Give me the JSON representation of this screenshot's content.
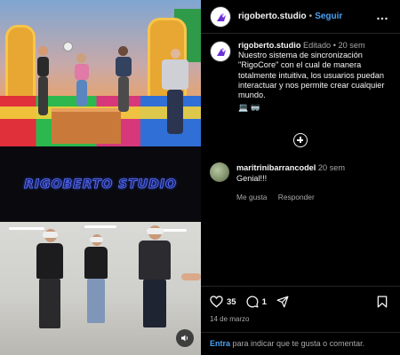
{
  "media": {
    "logo_text": "RIGOBERTO STUDIO",
    "sound_icon": "speaker-icon"
  },
  "post": {
    "username": "rigoberto.studio",
    "follow_label": "Seguir",
    "separator": "•",
    "more_icon": "more-icon",
    "caption_username": "rigoberto.studio",
    "edited_label": "Editado",
    "caption_time": "20 sem",
    "caption_text": "Nuestro sistema de sincronización \"RigoCore\" con el cual de manera totalmente intuitiva, los usuarios puedan interactuar y nos permite crear cualquier mundo.",
    "caption_emojis": "💻 🥽"
  },
  "comments": [
    {
      "username": "maritrinibarrancodel",
      "time": "20 sem",
      "text": "Genial!!!",
      "like_label": "Me gusta",
      "reply_label": "Responder"
    }
  ],
  "actions": {
    "likes_count": "35",
    "comments_count": "1",
    "date": "14 de marzo"
  },
  "footer": {
    "login_link": "Entra",
    "login_text": " para indicar que te gusta o comentar."
  },
  "colors": {
    "accent_blue": "#4aa3f5",
    "frame_blue": "#1e2d6b",
    "logo_blue": "#5b78ff"
  }
}
